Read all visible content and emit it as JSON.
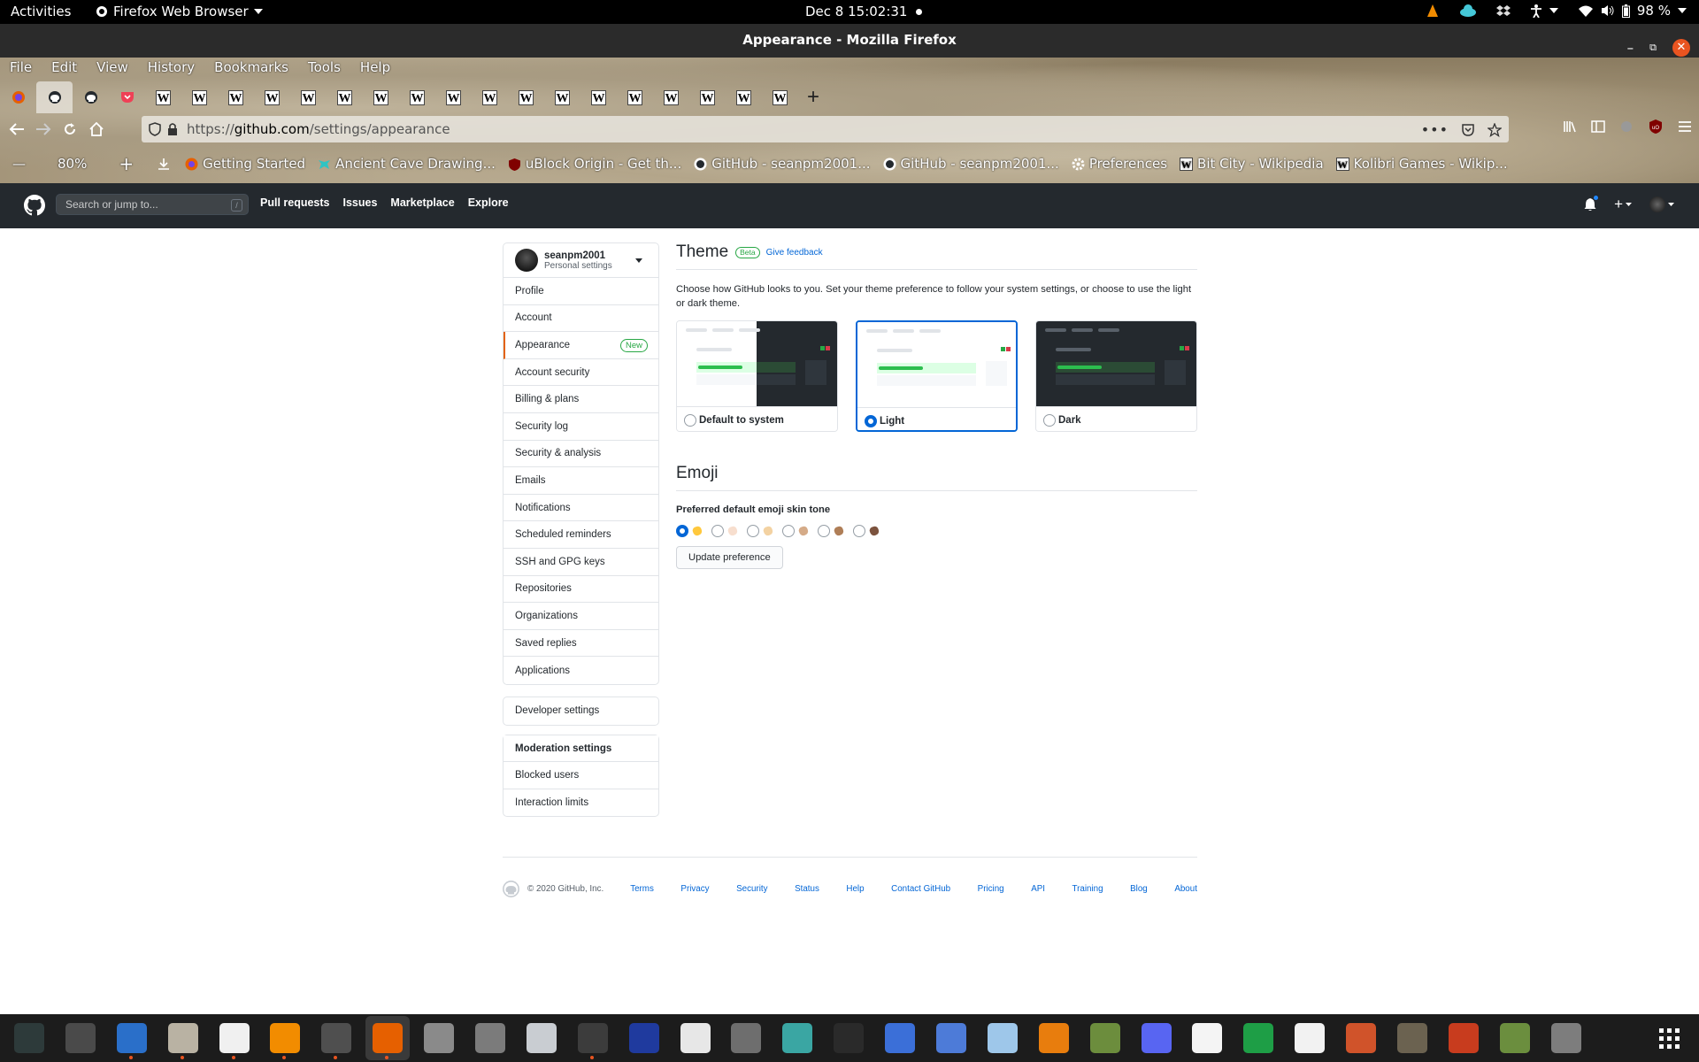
{
  "topbar": {
    "activities": "Activities",
    "app_name": "Firefox Web Browser",
    "datetime": "Dec 8  15:02:31",
    "battery": "98 %"
  },
  "window": {
    "title": "Appearance - Mozilla Firefox"
  },
  "menubar": [
    "File",
    "Edit",
    "View",
    "History",
    "Bookmarks",
    "Tools",
    "Help"
  ],
  "tabs": {
    "icons": [
      "firefox-icon",
      "github-icon",
      "github-icon",
      "pocket-icon",
      "wikipedia-icon",
      "wikipedia-icon",
      "wikipedia-icon",
      "wikipedia-icon",
      "wikipedia-icon",
      "wikipedia-icon",
      "wikipedia-icon",
      "wikipedia-icon",
      "wikipedia-icon",
      "wikipedia-icon",
      "wikipedia-icon",
      "wikipedia-icon",
      "wikipedia-icon",
      "wikipedia-icon",
      "wikipedia-icon",
      "wikipedia-icon",
      "wikipedia-icon",
      "wikipedia-icon"
    ],
    "active_index": 1
  },
  "urlbar": {
    "scheme": "https://",
    "host": "github.com",
    "path": "/settings/appearance",
    "zoom": "80%"
  },
  "bookmarks": [
    {
      "icon": "firefox-icon",
      "label": "Getting Started"
    },
    {
      "icon": "alien-icon",
      "label": "Ancient Cave Drawing..."
    },
    {
      "icon": "ublock-icon",
      "label": "uBlock Origin - Get th..."
    },
    {
      "icon": "github-icon",
      "label": "GitHub - seanpm2001..."
    },
    {
      "icon": "github-icon",
      "label": "GitHub - seanpm2001..."
    },
    {
      "icon": "gear-icon",
      "label": "Preferences"
    },
    {
      "icon": "wikipedia-icon",
      "label": "Bit City - Wikipedia"
    },
    {
      "icon": "wikipedia-icon",
      "label": "Kolibri Games - Wikip..."
    }
  ],
  "github": {
    "search_placeholder": "Search or jump to...",
    "search_key": "/",
    "nav": [
      "Pull requests",
      "Issues",
      "Marketplace",
      "Explore"
    ]
  },
  "sidebar": {
    "username": "seanpm2001",
    "subtitle": "Personal settings",
    "items": [
      {
        "label": "Profile"
      },
      {
        "label": "Account"
      },
      {
        "label": "Appearance",
        "badge": "New",
        "selected": true
      },
      {
        "label": "Account security"
      },
      {
        "label": "Billing & plans"
      },
      {
        "label": "Security log"
      },
      {
        "label": "Security & analysis"
      },
      {
        "label": "Emails"
      },
      {
        "label": "Notifications"
      },
      {
        "label": "Scheduled reminders"
      },
      {
        "label": "SSH and GPG keys"
      },
      {
        "label": "Repositories"
      },
      {
        "label": "Organizations"
      },
      {
        "label": "Saved replies"
      },
      {
        "label": "Applications"
      }
    ],
    "developer": "Developer settings",
    "moderation_header": "Moderation settings",
    "moderation_items": [
      "Blocked users",
      "Interaction limits"
    ]
  },
  "theme": {
    "heading": "Theme",
    "beta": "Beta",
    "feedback": "Give feedback",
    "description": "Choose how GitHub looks to you. Set your theme preference to follow your system settings, or choose to use the light or dark theme.",
    "options": [
      {
        "label": "Default to system",
        "selected": false
      },
      {
        "label": "Light",
        "selected": true
      },
      {
        "label": "Dark",
        "selected": false
      }
    ]
  },
  "emoji": {
    "heading": "Emoji",
    "label": "Preferred default emoji skin tone",
    "tones": [
      "#ffc83d",
      "#f7dece",
      "#f3d2a2",
      "#d5ab88",
      "#af7e57",
      "#7c533e"
    ],
    "selected_index": 0,
    "button": "Update preference"
  },
  "footer": {
    "copyright": "© 2020 GitHub, Inc.",
    "links": [
      "Terms",
      "Privacy",
      "Security",
      "Status",
      "Help",
      "Contact GitHub",
      "Pricing",
      "API",
      "Training",
      "Blog",
      "About"
    ]
  },
  "dock": {
    "apps": [
      {
        "name": "system-monitor-icon",
        "color": "#2d3a3a"
      },
      {
        "name": "extensions-icon",
        "color": "#4a4a4a"
      },
      {
        "name": "writer-icon",
        "color": "#2a6fc9"
      },
      {
        "name": "files-icon",
        "color": "#b9b2a3"
      },
      {
        "name": "text-editor-icon",
        "color": "#f0f0f0"
      },
      {
        "name": "vlc-icon",
        "color": "#f28c00"
      },
      {
        "name": "calculator-icon",
        "color": "#4f4f4f"
      },
      {
        "name": "firefox-icon",
        "color": "#e66000",
        "active": true
      },
      {
        "name": "settings-icon",
        "color": "#8a8a8a"
      },
      {
        "name": "image-viewer-icon",
        "color": "#7b7b7b"
      },
      {
        "name": "inkscape-icon",
        "color": "#c9cdd2"
      },
      {
        "name": "terminal-icon",
        "color": "#3c3c3c"
      },
      {
        "name": "atari-icon",
        "color": "#1f3a9e"
      },
      {
        "name": "audio-analyzer-icon",
        "color": "#e7e7e7"
      },
      {
        "name": "software-icon",
        "color": "#6e6e6e"
      },
      {
        "name": "calendar-icon",
        "color": "#3aa6a3"
      },
      {
        "name": "inkscape-dark-icon",
        "color": "#2a2a2a"
      },
      {
        "name": "tasks-icon",
        "color": "#3b6fd8"
      },
      {
        "name": "screenshot-icon",
        "color": "#4d7bd8"
      },
      {
        "name": "virtualbox-icon",
        "color": "#9ec7ea"
      },
      {
        "name": "blender-icon",
        "color": "#e87d0d"
      },
      {
        "name": "minecraft-launcher-icon",
        "color": "#6c8d3d"
      },
      {
        "name": "discord-icon",
        "color": "#5865f2"
      },
      {
        "name": "font-viewer-icon",
        "color": "#f4f4f4"
      },
      {
        "name": "calc-icon",
        "color": "#1e9e46"
      },
      {
        "name": "typora-icon",
        "color": "#f2f2f2"
      },
      {
        "name": "impress-icon",
        "color": "#d0532a"
      },
      {
        "name": "gimp-icon",
        "color": "#6b6250"
      },
      {
        "name": "mario-icon",
        "color": "#c83c1e"
      },
      {
        "name": "minecraft-icon",
        "color": "#6b8e3e"
      },
      {
        "name": "maps-icon",
        "color": "#7d7d7d"
      }
    ]
  }
}
